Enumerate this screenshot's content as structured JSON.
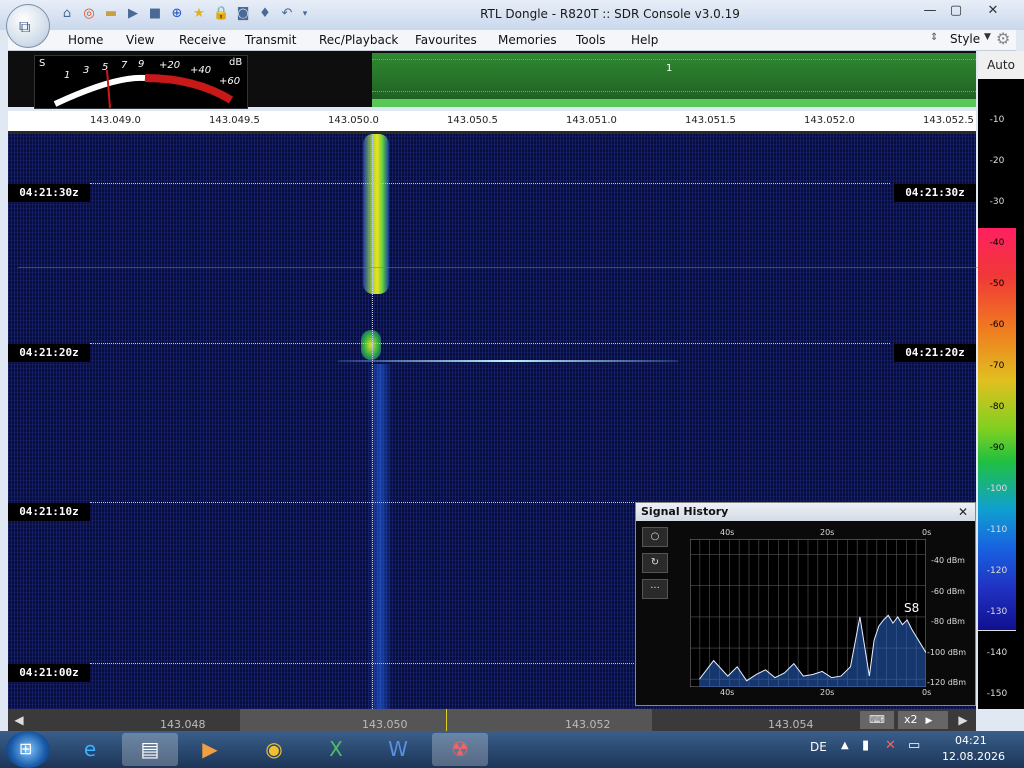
{
  "window": {
    "title": "RTL Dongle - R820T :: SDR Console v3.0.19",
    "minimize_label": "—",
    "maximize_label": "▢",
    "close_label": "✕"
  },
  "quick_access": [
    "home-icon",
    "lifebuoy-icon",
    "folder-icon",
    "play-icon",
    "stop-icon",
    "plus-icon",
    "star-icon",
    "lock-icon",
    "camera-icon",
    "drop-icon",
    "undo-icon"
  ],
  "menu": {
    "items": [
      "Home",
      "View",
      "Receive",
      "Transmit",
      "Rec/Playback",
      "Favourites",
      "Memories",
      "Tools",
      "Help"
    ],
    "style_label": "Style"
  },
  "smeter": {
    "s_label": "S",
    "db_label": "dB",
    "scale": [
      "1",
      "3",
      "5",
      "7",
      "9",
      "+20",
      "+40",
      "+60"
    ]
  },
  "spectrum": {
    "marker_label": "1",
    "auto_label": "Auto"
  },
  "freq_scale": [
    "143.049.0",
    "143.049.5",
    "143.050.0",
    "143.050.5",
    "143.051.0",
    "143.051.5",
    "143.052.0",
    "143.052.5"
  ],
  "waterfall": {
    "timestamps": [
      "04:21:30z",
      "04:21:20z",
      "04:21:10z",
      "04:21:00z"
    ]
  },
  "db_scale": [
    "-10",
    "-20",
    "-30",
    "-40",
    "-50",
    "-60",
    "-70",
    "-80",
    "-90",
    "-100",
    "-110",
    "-120",
    "-130",
    "-140",
    "-150"
  ],
  "signal_history": {
    "title": "Signal History",
    "close_label": "✕",
    "top_axis": [
      "40s",
      "20s",
      "0s"
    ],
    "bottom_axis": [
      "40s",
      "20s",
      "0s"
    ],
    "y_axis": [
      "-40 dBm",
      "-60 dBm",
      "-80 dBm",
      "-100 dBm",
      "-120 dBm"
    ],
    "s_reading": "S8",
    "button_labels": [
      "○",
      "↻",
      "···"
    ]
  },
  "bottom_bar": {
    "freqs": [
      "143.048",
      "143.050",
      "143.052",
      "143.054"
    ],
    "zoom_label": "x2"
  },
  "taskbar": {
    "language": "DE",
    "time": "04:21",
    "date": "12.08.2026"
  },
  "chart_data": {
    "type": "line",
    "title": "Signal History",
    "xlabel": "",
    "ylabel": "",
    "x_ticks": [
      "40s",
      "20s",
      "0s"
    ],
    "y_ticks": [
      "-40 dBm",
      "-60 dBm",
      "-80 dBm",
      "-100 dBm",
      "-120 dBm"
    ],
    "ylim": [
      -125,
      -30
    ],
    "series": [
      {
        "x": [
          48,
          45,
          42,
          40,
          38,
          36,
          34,
          32,
          30,
          28,
          26,
          24,
          22,
          20,
          18,
          16,
          14,
          12,
          11,
          10,
          9,
          8,
          7,
          6,
          5,
          4,
          3,
          2,
          1,
          0
        ],
        "values": [
          -120,
          -108,
          -118,
          -112,
          -121,
          -117,
          -114,
          -119,
          -116,
          -110,
          -118,
          -117,
          -115,
          -119,
          -118,
          -112,
          -80,
          -118,
          -95,
          -86,
          -82,
          -79,
          -84,
          -80,
          -85,
          -82,
          -88,
          -93,
          -98,
          -103
        ]
      }
    ]
  }
}
